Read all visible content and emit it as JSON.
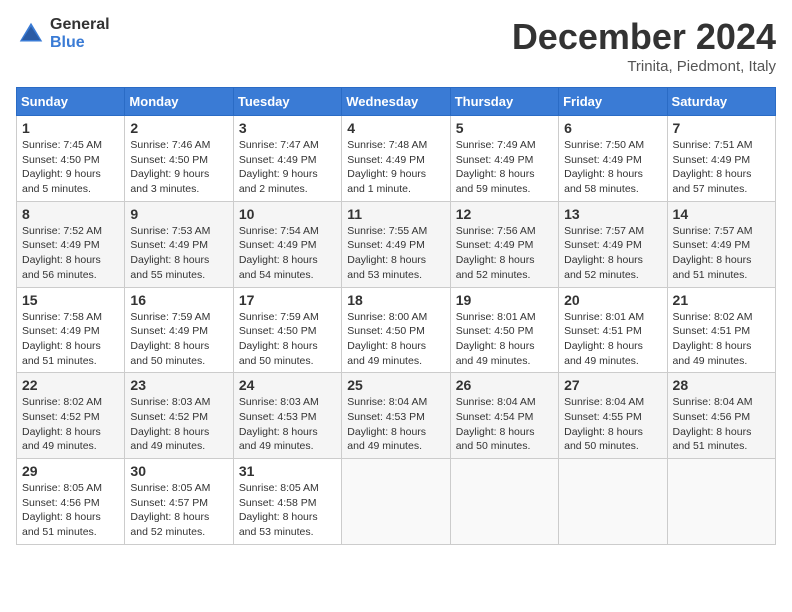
{
  "logo": {
    "general": "General",
    "blue": "Blue"
  },
  "header": {
    "month": "December 2024",
    "location": "Trinita, Piedmont, Italy"
  },
  "weekdays": [
    "Sunday",
    "Monday",
    "Tuesday",
    "Wednesday",
    "Thursday",
    "Friday",
    "Saturday"
  ],
  "weeks": [
    [
      {
        "day": "1",
        "sunrise": "7:45 AM",
        "sunset": "4:50 PM",
        "daylight": "9 hours and 5 minutes."
      },
      {
        "day": "2",
        "sunrise": "7:46 AM",
        "sunset": "4:50 PM",
        "daylight": "9 hours and 3 minutes."
      },
      {
        "day": "3",
        "sunrise": "7:47 AM",
        "sunset": "4:49 PM",
        "daylight": "9 hours and 2 minutes."
      },
      {
        "day": "4",
        "sunrise": "7:48 AM",
        "sunset": "4:49 PM",
        "daylight": "9 hours and 1 minute."
      },
      {
        "day": "5",
        "sunrise": "7:49 AM",
        "sunset": "4:49 PM",
        "daylight": "8 hours and 59 minutes."
      },
      {
        "day": "6",
        "sunrise": "7:50 AM",
        "sunset": "4:49 PM",
        "daylight": "8 hours and 58 minutes."
      },
      {
        "day": "7",
        "sunrise": "7:51 AM",
        "sunset": "4:49 PM",
        "daylight": "8 hours and 57 minutes."
      }
    ],
    [
      {
        "day": "8",
        "sunrise": "7:52 AM",
        "sunset": "4:49 PM",
        "daylight": "8 hours and 56 minutes."
      },
      {
        "day": "9",
        "sunrise": "7:53 AM",
        "sunset": "4:49 PM",
        "daylight": "8 hours and 55 minutes."
      },
      {
        "day": "10",
        "sunrise": "7:54 AM",
        "sunset": "4:49 PM",
        "daylight": "8 hours and 54 minutes."
      },
      {
        "day": "11",
        "sunrise": "7:55 AM",
        "sunset": "4:49 PM",
        "daylight": "8 hours and 53 minutes."
      },
      {
        "day": "12",
        "sunrise": "7:56 AM",
        "sunset": "4:49 PM",
        "daylight": "8 hours and 52 minutes."
      },
      {
        "day": "13",
        "sunrise": "7:57 AM",
        "sunset": "4:49 PM",
        "daylight": "8 hours and 52 minutes."
      },
      {
        "day": "14",
        "sunrise": "7:57 AM",
        "sunset": "4:49 PM",
        "daylight": "8 hours and 51 minutes."
      }
    ],
    [
      {
        "day": "15",
        "sunrise": "7:58 AM",
        "sunset": "4:49 PM",
        "daylight": "8 hours and 51 minutes."
      },
      {
        "day": "16",
        "sunrise": "7:59 AM",
        "sunset": "4:49 PM",
        "daylight": "8 hours and 50 minutes."
      },
      {
        "day": "17",
        "sunrise": "7:59 AM",
        "sunset": "4:50 PM",
        "daylight": "8 hours and 50 minutes."
      },
      {
        "day": "18",
        "sunrise": "8:00 AM",
        "sunset": "4:50 PM",
        "daylight": "8 hours and 49 minutes."
      },
      {
        "day": "19",
        "sunrise": "8:01 AM",
        "sunset": "4:50 PM",
        "daylight": "8 hours and 49 minutes."
      },
      {
        "day": "20",
        "sunrise": "8:01 AM",
        "sunset": "4:51 PM",
        "daylight": "8 hours and 49 minutes."
      },
      {
        "day": "21",
        "sunrise": "8:02 AM",
        "sunset": "4:51 PM",
        "daylight": "8 hours and 49 minutes."
      }
    ],
    [
      {
        "day": "22",
        "sunrise": "8:02 AM",
        "sunset": "4:52 PM",
        "daylight": "8 hours and 49 minutes."
      },
      {
        "day": "23",
        "sunrise": "8:03 AM",
        "sunset": "4:52 PM",
        "daylight": "8 hours and 49 minutes."
      },
      {
        "day": "24",
        "sunrise": "8:03 AM",
        "sunset": "4:53 PM",
        "daylight": "8 hours and 49 minutes."
      },
      {
        "day": "25",
        "sunrise": "8:04 AM",
        "sunset": "4:53 PM",
        "daylight": "8 hours and 49 minutes."
      },
      {
        "day": "26",
        "sunrise": "8:04 AM",
        "sunset": "4:54 PM",
        "daylight": "8 hours and 50 minutes."
      },
      {
        "day": "27",
        "sunrise": "8:04 AM",
        "sunset": "4:55 PM",
        "daylight": "8 hours and 50 minutes."
      },
      {
        "day": "28",
        "sunrise": "8:04 AM",
        "sunset": "4:56 PM",
        "daylight": "8 hours and 51 minutes."
      }
    ],
    [
      {
        "day": "29",
        "sunrise": "8:05 AM",
        "sunset": "4:56 PM",
        "daylight": "8 hours and 51 minutes."
      },
      {
        "day": "30",
        "sunrise": "8:05 AM",
        "sunset": "4:57 PM",
        "daylight": "8 hours and 52 minutes."
      },
      {
        "day": "31",
        "sunrise": "8:05 AM",
        "sunset": "4:58 PM",
        "daylight": "8 hours and 53 minutes."
      },
      null,
      null,
      null,
      null
    ]
  ]
}
